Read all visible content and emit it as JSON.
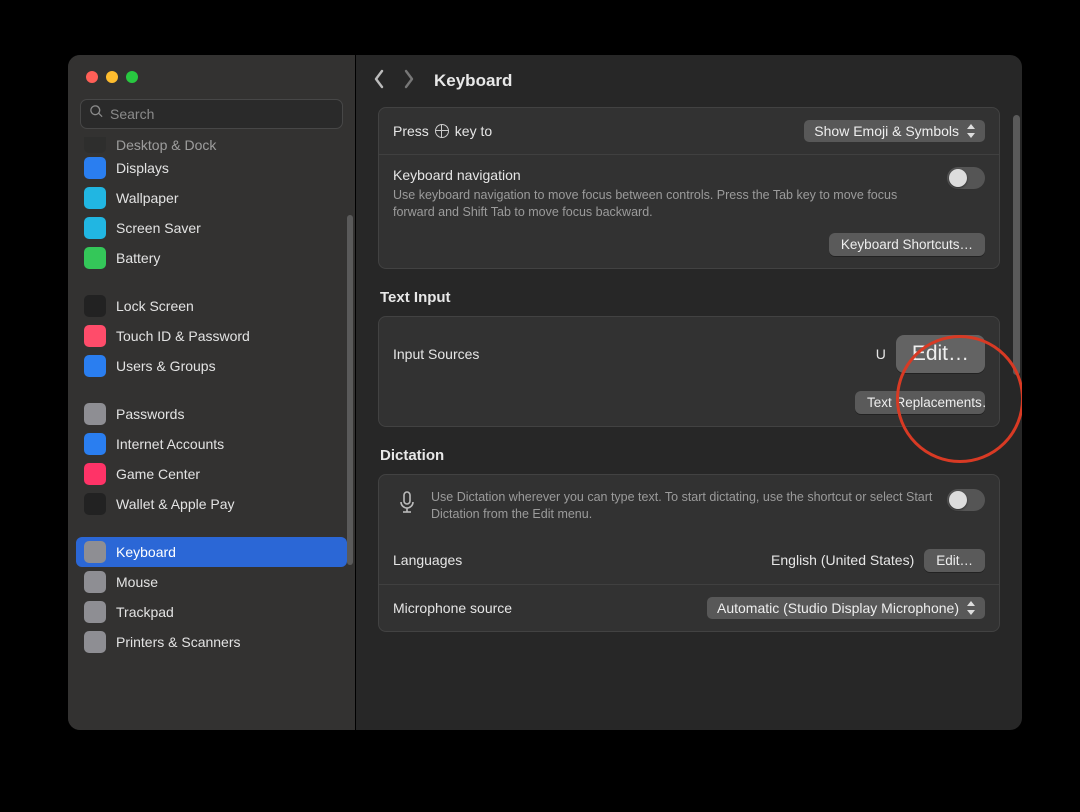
{
  "header": {
    "title": "Keyboard"
  },
  "search": {
    "placeholder": "Search"
  },
  "sidebar": {
    "items": [
      {
        "label": "Desktop & Dock",
        "color": "#2c2c2c",
        "cutoff": true
      },
      {
        "label": "Displays",
        "color": "#2a7ef0"
      },
      {
        "label": "Wallpaper",
        "color": "#21b6e2"
      },
      {
        "label": "Screen Saver",
        "color": "#21b6e2"
      },
      {
        "label": "Battery",
        "color": "#34c759"
      },
      {
        "gap": true
      },
      {
        "label": "Lock Screen",
        "color": "#222"
      },
      {
        "label": "Touch ID & Password",
        "color": "#ff4c6a"
      },
      {
        "label": "Users & Groups",
        "color": "#2a7ef0"
      },
      {
        "gap": true
      },
      {
        "label": "Passwords",
        "color": "#8e8e93"
      },
      {
        "label": "Internet Accounts",
        "color": "#2a7ef0"
      },
      {
        "label": "Game Center",
        "color": "#ff3367"
      },
      {
        "label": "Wallet & Apple Pay",
        "color": "#222"
      },
      {
        "gap": true
      },
      {
        "label": "Keyboard",
        "color": "#8e8e93",
        "selected": true
      },
      {
        "label": "Mouse",
        "color": "#8e8e93"
      },
      {
        "label": "Trackpad",
        "color": "#8e8e93"
      },
      {
        "label": "Printers & Scanners",
        "color": "#8e8e93"
      }
    ]
  },
  "press_key": {
    "label_prefix": "Press",
    "label_suffix": "key to",
    "value": "Show Emoji & Symbols"
  },
  "keyboard_nav": {
    "title": "Keyboard navigation",
    "desc": "Use keyboard navigation to move focus between controls. Press the Tab key to move focus forward and Shift Tab to move focus backward.",
    "on": false
  },
  "keyboard_shortcuts_btn": "Keyboard Shortcuts…",
  "text_input": {
    "section": "Text Input",
    "input_sources_label": "Input Sources",
    "input_sources_value": "U",
    "edit_btn": "Edit…",
    "text_replacements_btn": "Text Replacements…"
  },
  "dictation": {
    "section": "Dictation",
    "desc": "Use Dictation wherever you can type text. To start dictating, use the shortcut or select Start Dictation from the Edit menu.",
    "on": false,
    "languages_label": "Languages",
    "languages_value": "English (United States)",
    "languages_edit": "Edit…",
    "mic_label": "Microphone source",
    "mic_value": "Automatic (Studio Display Microphone)"
  }
}
